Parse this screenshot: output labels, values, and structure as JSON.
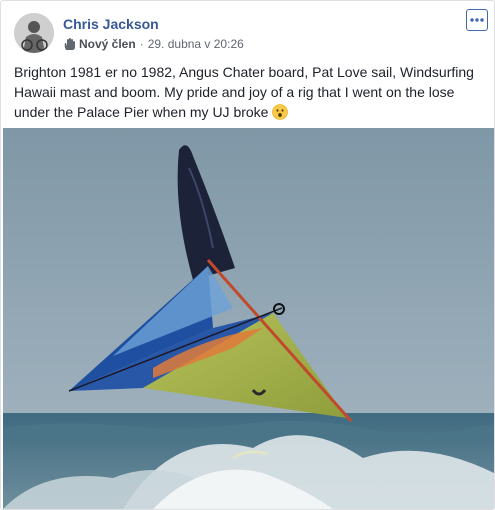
{
  "post": {
    "author": "Chris Jackson",
    "badge": "Nový člen",
    "separator": "·",
    "timestamp": "29. dubna v 20:26",
    "text": "Brighton 1981 er no 1982, Angus Chater board, Pat Love sail, Windsurfing Hawaii mast and boom. My pride and joy of a rig that I went on the lose under the Palace Pier when my UJ broke",
    "emoji_icon": "surprised-face-emoji",
    "options_icon": "more-options-icon"
  },
  "colors": {
    "author_link": "#385898",
    "meta_text": "#606770",
    "body_text": "#1d2129",
    "border": "#dddfe2"
  }
}
